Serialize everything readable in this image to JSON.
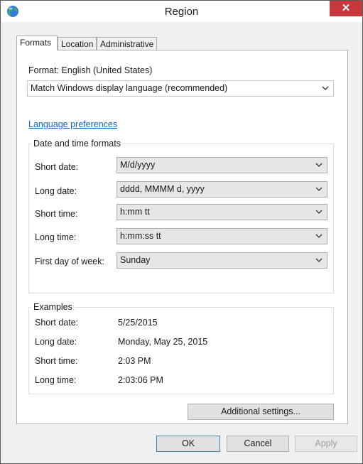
{
  "window": {
    "title": "Region",
    "close_glyph": "✕",
    "icon": "globe-icon"
  },
  "tabs": [
    {
      "label": "Formats",
      "active": true
    },
    {
      "label": "Location",
      "active": false
    },
    {
      "label": "Administrative",
      "active": false
    }
  ],
  "formats": {
    "format_label": "Format: English (United States)",
    "format_value": "Match Windows display language (recommended)",
    "language_link": "Language preferences"
  },
  "date_time": {
    "group_title": "Date and time formats",
    "rows": [
      {
        "label": "Short date:",
        "value": "M/d/yyyy"
      },
      {
        "label": "Long date:",
        "value": "dddd, MMMM d, yyyy"
      },
      {
        "label": "Short time:",
        "value": "h:mm tt"
      },
      {
        "label": "Long time:",
        "value": "h:mm:ss tt"
      },
      {
        "label": "First day of week:",
        "value": "Sunday"
      }
    ]
  },
  "examples": {
    "group_title": "Examples",
    "rows": [
      {
        "label": "Short date:",
        "value": "5/25/2015"
      },
      {
        "label": "Long date:",
        "value": "Monday, May 25, 2015"
      },
      {
        "label": "Short time:",
        "value": "2:03 PM"
      },
      {
        "label": "Long time:",
        "value": "2:03:06 PM"
      }
    ]
  },
  "buttons": {
    "additional": "Additional settings...",
    "ok": "OK",
    "cancel": "Cancel",
    "apply": "Apply"
  },
  "colors": {
    "close": "#c7383d",
    "link": "#1565c0"
  }
}
